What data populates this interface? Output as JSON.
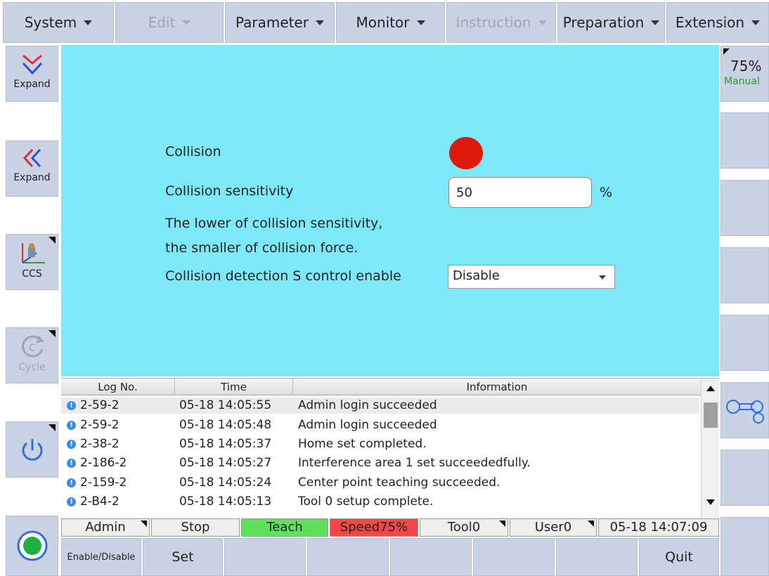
{
  "menu": [
    {
      "label": "System",
      "enabled": true
    },
    {
      "label": "Edit",
      "enabled": false
    },
    {
      "label": "Parameter",
      "enabled": true
    },
    {
      "label": "Monitor",
      "enabled": true
    },
    {
      "label": "Instruction",
      "enabled": false
    },
    {
      "label": "Preparation",
      "enabled": true
    },
    {
      "label": "Extension",
      "enabled": true
    }
  ],
  "left": {
    "expand1": "Expand",
    "expand2": "Expand",
    "ccs": "CCS",
    "cycle": "Cycle"
  },
  "right": {
    "speed": "75%",
    "mode": "Manual"
  },
  "panel": {
    "collision_label": "Collision",
    "collision_status_color": "#e01a0a",
    "sensitivity_label": "Collision sensitivity",
    "sensitivity_value": "50",
    "sensitivity_unit": "%",
    "note_line1": "The lower of collision sensitivity,",
    "note_line2": "the smaller of collision force.",
    "s_control_label": "Collision detection S control enable",
    "s_control_value": "Disable"
  },
  "log": {
    "headers": [
      "Log No.",
      "Time",
      "Information"
    ],
    "rows": [
      {
        "no": "2-59-2",
        "time": "05-18 14:05:55",
        "info": "Admin  login succeeded"
      },
      {
        "no": "2-59-2",
        "time": "05-18 14:05:48",
        "info": "Admin  login succeeded"
      },
      {
        "no": "2-38-2",
        "time": "05-18 14:05:37",
        "info": "Home set completed."
      },
      {
        "no": "2-186-2",
        "time": "05-18 14:05:27",
        "info": "Interference area 1 set succeededfully."
      },
      {
        "no": "2-159-2",
        "time": "05-18 14:05:24",
        "info": "Center point teaching succeeded."
      },
      {
        "no": "2-B4-2",
        "time": "05-18 14:05:13",
        "info": "Tool 0 setup complete."
      }
    ]
  },
  "status": {
    "user": "Admin",
    "run": "Stop",
    "mode": "Teach",
    "speed": "Speed75%",
    "tool": "Tool0",
    "userframe": "User0",
    "datetime": "05-18 14:07:09",
    "colors": {
      "teach": "#5fe05f",
      "speed": "#f04848"
    }
  },
  "bottom": {
    "enable": "Enable/Disable",
    "set": "Set",
    "quit": "Quit"
  }
}
